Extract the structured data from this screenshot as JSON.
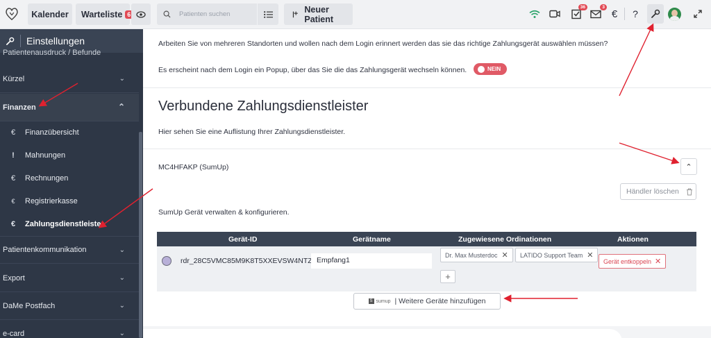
{
  "topbar": {
    "calendar_label": "Kalender",
    "waitlist_label": "Warteliste",
    "waitlist_count": "6",
    "search_placeholder": "Patienten suchen",
    "new_patient_label": "Neuer Patient",
    "tasks_count": "36",
    "messages_count": "3"
  },
  "sidebar": {
    "title": "Einstellungen",
    "cut_item": "Patientenausdruck / Befunde",
    "sections": [
      {
        "label": "Kürzel"
      },
      {
        "label": "Finanzen"
      },
      {
        "label": "Patientenkommunikation"
      },
      {
        "label": "Export"
      },
      {
        "label": "DaMe Postfach"
      },
      {
        "label": "e-card"
      }
    ],
    "finance_items": [
      {
        "label": "Finanzübersicht",
        "icon": "coin-icon",
        "glyph": "€"
      },
      {
        "label": "Mahnungen",
        "icon": "exclamation-icon",
        "glyph": "!"
      },
      {
        "label": "Rechnungen",
        "icon": "euro-icon",
        "glyph": "€"
      },
      {
        "label": "Registrierkasse",
        "icon": "register-icon",
        "glyph": "€"
      },
      {
        "label": "Zahlungsdienstleister",
        "icon": "euro-icon",
        "glyph": "€"
      }
    ]
  },
  "main": {
    "intro_text": "Arbeiten Sie von mehreren Standorten und wollen nach dem Login erinnert werden das sie das richtige Zahlungsgerät auswählen müssen?",
    "popup_text": "Es erscheint nach dem Login ein Popup, über das Sie die das Zahlungsgerät wechseln können.",
    "toggle_label": "NEIN",
    "heading": "Verbundene Zahlungsdienstleister",
    "subtext": "Hier sehen Sie eine Auflistung Ihrer Zahlungsdienstleister.",
    "provider_name": "MC4HFAKP (SumUp)",
    "delete_label": "Händler löschen",
    "manage_text": "SumUp Gerät verwalten & konfigurieren.",
    "table": {
      "headers": [
        "Gerät-ID",
        "Gerätname",
        "Zugewiesene Ordinationen",
        "Aktionen"
      ],
      "row": {
        "device_id": "rdr_28C5VMC85M9K8T5XXEVSW4NTZ",
        "device_name": "Empfang1",
        "ordinations": [
          "Dr. Max Musterdoc",
          "LATIDO Support Team"
        ],
        "unlink_label": "Gerät entkoppeln"
      }
    },
    "sumup_logo": "sumup",
    "add_devices_label": "| Weitere Geräte hinzufügen"
  },
  "colors": {
    "sidebar_bg": "#2e3746",
    "accent_red": "#e05a66",
    "table_header": "#3a4454",
    "annotation_arrow": "#e0212f"
  }
}
